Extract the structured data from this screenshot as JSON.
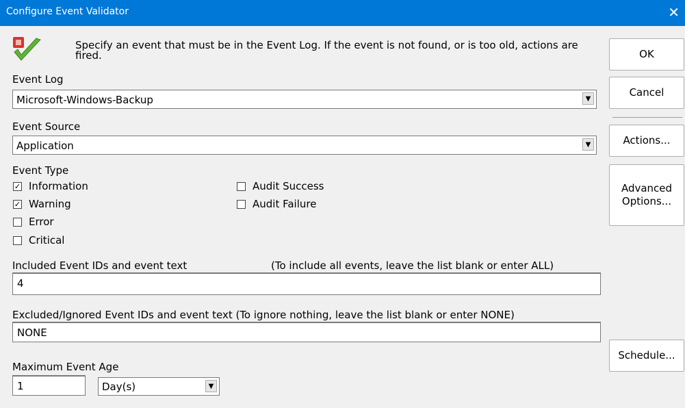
{
  "window": {
    "title": "Configure Event Validator",
    "close_glyph": "✕"
  },
  "header": {
    "icon": "checkmark-icon",
    "description": "Specify an event that must be in the Event Log.  If the event is not found, or is too old, actions are fired."
  },
  "event_log": {
    "label": "Event Log",
    "value": "Microsoft-Windows-Backup"
  },
  "event_source": {
    "label": "Event Source",
    "value": "Application"
  },
  "event_type": {
    "label": "Event Type",
    "options": [
      {
        "label": "Information",
        "checked": true
      },
      {
        "label": "Warning",
        "checked": true
      },
      {
        "label": "Error",
        "checked": false
      },
      {
        "label": "Critical",
        "checked": false
      },
      {
        "label": "Audit Success",
        "checked": false
      },
      {
        "label": "Audit Failure",
        "checked": false
      }
    ]
  },
  "included": {
    "label": "Included Event IDs and event text",
    "hint": "(To include all events, leave the list blank or enter ALL)",
    "value": "4"
  },
  "excluded": {
    "label": "Excluded/Ignored Event IDs and event text  (To ignore nothing, leave the list blank or enter NONE)",
    "value": "NONE"
  },
  "max_age": {
    "label": "Maximum Event Age",
    "value": "1",
    "unit": "Day(s)"
  },
  "buttons": {
    "ok": "OK",
    "cancel": "Cancel",
    "actions": "Actions...",
    "advanced": "Advanced Options...",
    "schedule": "Schedule..."
  },
  "colors": {
    "titlebar": "#0078d7",
    "background": "#f0f0f0"
  }
}
